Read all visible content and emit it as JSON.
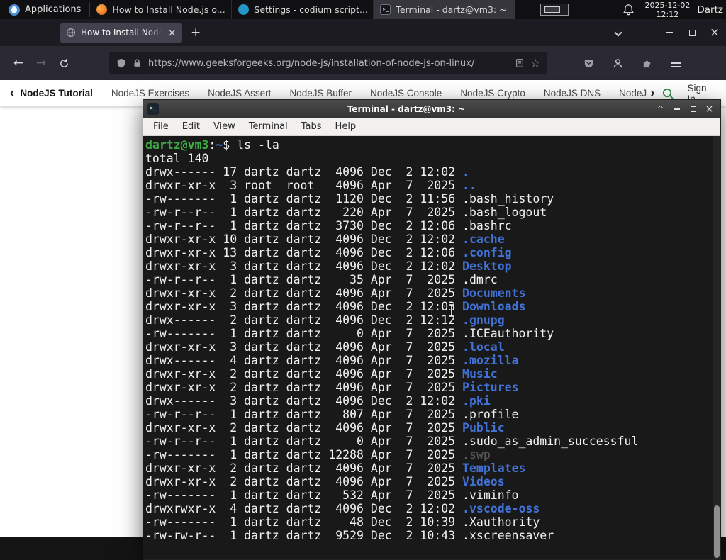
{
  "panel": {
    "applications_label": "Applications",
    "taskbar_items": [
      {
        "label": "How to Install Node.js o...",
        "icon": "firefox-icon"
      },
      {
        "label": "Settings - codium script...",
        "icon": "codium-icon"
      },
      {
        "label": "Terminal - dartz@vm3: ~",
        "icon": "terminal-icon"
      }
    ],
    "clock": {
      "date": "2025-12-02",
      "time": "12:12"
    },
    "user_label": "Dartz"
  },
  "browser": {
    "tab": {
      "title": "How to Install Node.js on..."
    },
    "toolbar": {
      "url": "https://www.geeksforgeeks.org/node-js/installation-of-node-js-on-linux/"
    },
    "site_nav": {
      "items": [
        "NodeJS Tutorial",
        "NodeJS Exercises",
        "NodeJS Assert",
        "NodeJS Buffer",
        "NodeJS Console",
        "NodeJS Crypto",
        "NodeJS DNS",
        "NodeJS"
      ],
      "sign_in_label": "Sign In"
    }
  },
  "terminal": {
    "title": "Terminal - dartz@vm3: ~",
    "menu_items": [
      "File",
      "Edit",
      "View",
      "Terminal",
      "Tabs",
      "Help"
    ],
    "lines": [
      [
        {
          "t": "dartz@vm3",
          "c": "green"
        },
        {
          "t": ":",
          "c": "fg"
        },
        {
          "t": "~",
          "c": "blue"
        },
        {
          "t": "$ ls -la",
          "c": "fg"
        }
      ],
      [
        {
          "t": "total 140",
          "c": "fg"
        }
      ],
      [
        {
          "t": "drwx------ 17 dartz dartz  4096 Dec  2 12:02 ",
          "c": "fg"
        },
        {
          "t": ".",
          "c": "blue"
        }
      ],
      [
        {
          "t": "drwxr-xr-x  3 root  root   4096 Apr  7  2025 ",
          "c": "fg"
        },
        {
          "t": "..",
          "c": "blue"
        }
      ],
      [
        {
          "t": "-rw-------  1 dartz dartz  1120 Dec  2 11:56 .bash_history",
          "c": "fg"
        }
      ],
      [
        {
          "t": "-rw-r--r--  1 dartz dartz   220 Apr  7  2025 .bash_logout",
          "c": "fg"
        }
      ],
      [
        {
          "t": "-rw-r--r--  1 dartz dartz  3730 Dec  2 12:06 .bashrc",
          "c": "fg"
        }
      ],
      [
        {
          "t": "drwxr-xr-x 10 dartz dartz  4096 Dec  2 12:02 ",
          "c": "fg"
        },
        {
          "t": ".cache",
          "c": "blue"
        }
      ],
      [
        {
          "t": "drwxr-xr-x 13 dartz dartz  4096 Dec  2 12:06 ",
          "c": "fg"
        },
        {
          "t": ".config",
          "c": "blue"
        }
      ],
      [
        {
          "t": "drwxr-xr-x  3 dartz dartz  4096 Dec  2 12:02 ",
          "c": "fg"
        },
        {
          "t": "Desktop",
          "c": "blue"
        }
      ],
      [
        {
          "t": "-rw-r--r--  1 dartz dartz    35 Apr  7  2025 .dmrc",
          "c": "fg"
        }
      ],
      [
        {
          "t": "drwxr-xr-x  2 dartz dartz  4096 Apr  7  2025 ",
          "c": "fg"
        },
        {
          "t": "Documents",
          "c": "blue"
        }
      ],
      [
        {
          "t": "drwxr-xr-x  3 dartz dartz  4096 Dec  2 12:03 ",
          "c": "fg"
        },
        {
          "t": "Downloads",
          "c": "blue"
        }
      ],
      [
        {
          "t": "drwx------  2 dartz dartz  4096 Dec  2 12:12 ",
          "c": "fg"
        },
        {
          "t": ".gnupg",
          "c": "blue"
        }
      ],
      [
        {
          "t": "-rw-------  1 dartz dartz     0 Apr  7  2025 .ICEauthority",
          "c": "fg"
        }
      ],
      [
        {
          "t": "drwxr-xr-x  3 dartz dartz  4096 Apr  7  2025 ",
          "c": "fg"
        },
        {
          "t": ".local",
          "c": "blue"
        }
      ],
      [
        {
          "t": "drwx------  4 dartz dartz  4096 Apr  7  2025 ",
          "c": "fg"
        },
        {
          "t": ".mozilla",
          "c": "blue"
        }
      ],
      [
        {
          "t": "drwxr-xr-x  2 dartz dartz  4096 Apr  7  2025 ",
          "c": "fg"
        },
        {
          "t": "Music",
          "c": "blue"
        }
      ],
      [
        {
          "t": "drwxr-xr-x  2 dartz dartz  4096 Apr  7  2025 ",
          "c": "fg"
        },
        {
          "t": "Pictures",
          "c": "blue"
        }
      ],
      [
        {
          "t": "drwx------  3 dartz dartz  4096 Dec  2 12:02 ",
          "c": "fg"
        },
        {
          "t": ".pki",
          "c": "blue"
        }
      ],
      [
        {
          "t": "-rw-r--r--  1 dartz dartz   807 Apr  7  2025 .profile",
          "c": "fg"
        }
      ],
      [
        {
          "t": "drwxr-xr-x  2 dartz dartz  4096 Apr  7  2025 ",
          "c": "fg"
        },
        {
          "t": "Public",
          "c": "blue"
        }
      ],
      [
        {
          "t": "-rw-r--r--  1 dartz dartz     0 Apr  7  2025 .sudo_as_admin_successful",
          "c": "fg"
        }
      ],
      [
        {
          "t": "-rw-------  1 dartz dartz 12288 Apr  7  2025 ",
          "c": "fg"
        },
        {
          "t": ".swp",
          "c": "dim"
        }
      ],
      [
        {
          "t": "drwxr-xr-x  2 dartz dartz  4096 Apr  7  2025 ",
          "c": "fg"
        },
        {
          "t": "Templates",
          "c": "blue"
        }
      ],
      [
        {
          "t": "drwxr-xr-x  2 dartz dartz  4096 Apr  7  2025 ",
          "c": "fg"
        },
        {
          "t": "Videos",
          "c": "blue"
        }
      ],
      [
        {
          "t": "-rw-------  1 dartz dartz   532 Apr  7  2025 .viminfo",
          "c": "fg"
        }
      ],
      [
        {
          "t": "drwxrwxr-x  4 dartz dartz  4096 Dec  2 12:02 ",
          "c": "fg"
        },
        {
          "t": ".vscode-oss",
          "c": "blue"
        }
      ],
      [
        {
          "t": "-rw-------  1 dartz dartz    48 Dec  2 10:39 .Xauthority",
          "c": "fg"
        }
      ],
      [
        {
          "t": "-rw-rw-r--  1 dartz dartz  9529 Dec  2 10:43 .xscreensaver",
          "c": "fg"
        }
      ]
    ]
  },
  "colors": {
    "gfg_green": "#2f8d46",
    "terminal_prompt_green": "#3fab45",
    "terminal_dir_blue": "#4272d8",
    "firefox_toolbar": "#2b2a33",
    "panel_background": "#101012"
  }
}
